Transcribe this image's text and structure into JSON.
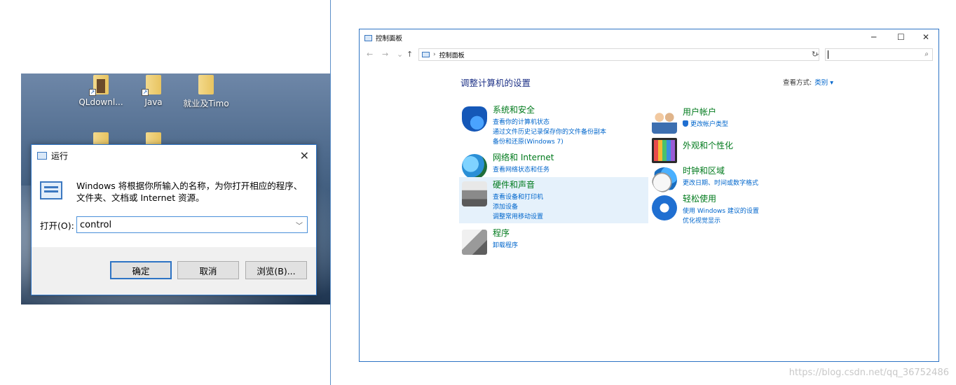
{
  "desktop": {
    "icons": [
      {
        "label": "QLdownl...",
        "icon": "folder-shortcut-icon"
      },
      {
        "label": "Java",
        "icon": "folder-shortcut-icon"
      },
      {
        "label": "就业及Timo",
        "icon": "folder-icon"
      }
    ]
  },
  "run_dialog": {
    "title": "运行",
    "close": "✕",
    "description": "Windows 将根据你所输入的名称，为你打开相应的程序、文件夹、文档或 Internet 资源。",
    "open_label": "打开(O):",
    "input_value": "control",
    "ok_label": "确定",
    "cancel_label": "取消",
    "browse_label": "浏览(B)..."
  },
  "control_panel": {
    "title": "控制面板",
    "minimize": "─",
    "maximize": "☐",
    "close": "✕",
    "nav": {
      "back": "←",
      "forward": "→",
      "recent": "⌄",
      "up": "↑"
    },
    "address_sep": "›",
    "address": "控制面板",
    "address_dropdown": "⌄",
    "refresh": "↻",
    "search_icon": "⌕",
    "heading": "调整计算机的设置",
    "view_by_label": "查看方式:",
    "view_by_value": "类别 ▾",
    "categories_left": [
      {
        "title": "系统和安全",
        "links": [
          "查看你的计算机状态",
          "通过文件历史记录保存你的文件备份副本",
          "备份和还原(Windows 7)"
        ],
        "icon": "shield-icon"
      },
      {
        "title": "网络和 Internet",
        "links": [
          "查看网络状态和任务"
        ],
        "icon": "network-globe-icon"
      },
      {
        "title": "硬件和声音",
        "links": [
          "查看设备和打印机",
          "添加设备",
          "调整常用移动设置"
        ],
        "icon": "printer-icon"
      },
      {
        "title": "程序",
        "links": [
          "卸载程序"
        ],
        "icon": "programs-box-icon"
      }
    ],
    "categories_right": [
      {
        "title": "用户帐户",
        "links": [
          "更改帐户类型"
        ],
        "icon": "users-icon"
      },
      {
        "title": "外观和个性化",
        "links": [],
        "icon": "monitor-icon"
      },
      {
        "title": "时钟和区域",
        "links": [
          "更改日期、时间或数字格式"
        ],
        "icon": "clock-globe-icon"
      },
      {
        "title": "轻松使用",
        "links": [
          "使用 Windows 建议的设置",
          "优化视觉显示"
        ],
        "icon": "ease-of-access-icon"
      }
    ]
  },
  "watermark": "https://blog.csdn.net/qq_36752486",
  "colors": {
    "accent": "#2d73c4",
    "link": "#0066cc",
    "category_title": "#007a1c",
    "heading": "#1e3287"
  }
}
